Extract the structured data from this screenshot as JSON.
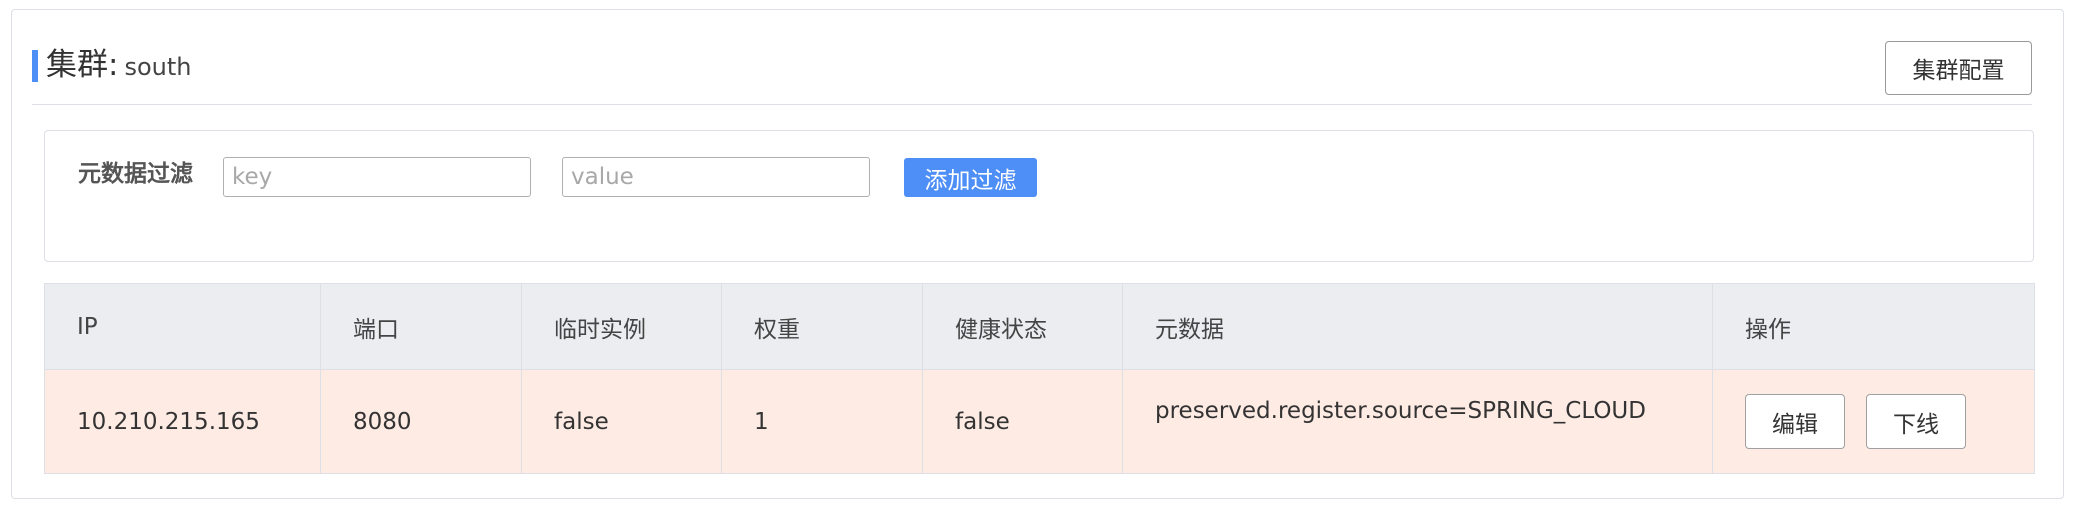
{
  "header": {
    "title_prefix": "集群:",
    "cluster_name": "south",
    "cluster_config_label": "集群配置"
  },
  "filter": {
    "label": "元数据过滤",
    "key_placeholder": "key",
    "value_placeholder": "value",
    "add_label": "添加过滤"
  },
  "table": {
    "columns": [
      "IP",
      "端口",
      "临时实例",
      "权重",
      "健康状态",
      "元数据",
      "操作"
    ],
    "rows": [
      {
        "ip": "10.210.215.165",
        "port": "8080",
        "ephemeral": "false",
        "weight": "1",
        "healthy": "false",
        "metadata": "preserved.register.source=SPRING_CLOUD",
        "edit_label": "编辑",
        "offline_label": "下线"
      }
    ]
  },
  "colors": {
    "accent": "#4d8ef7",
    "header_bg": "#ebedf1",
    "row_unhealthy_bg": "#fdebe4"
  }
}
